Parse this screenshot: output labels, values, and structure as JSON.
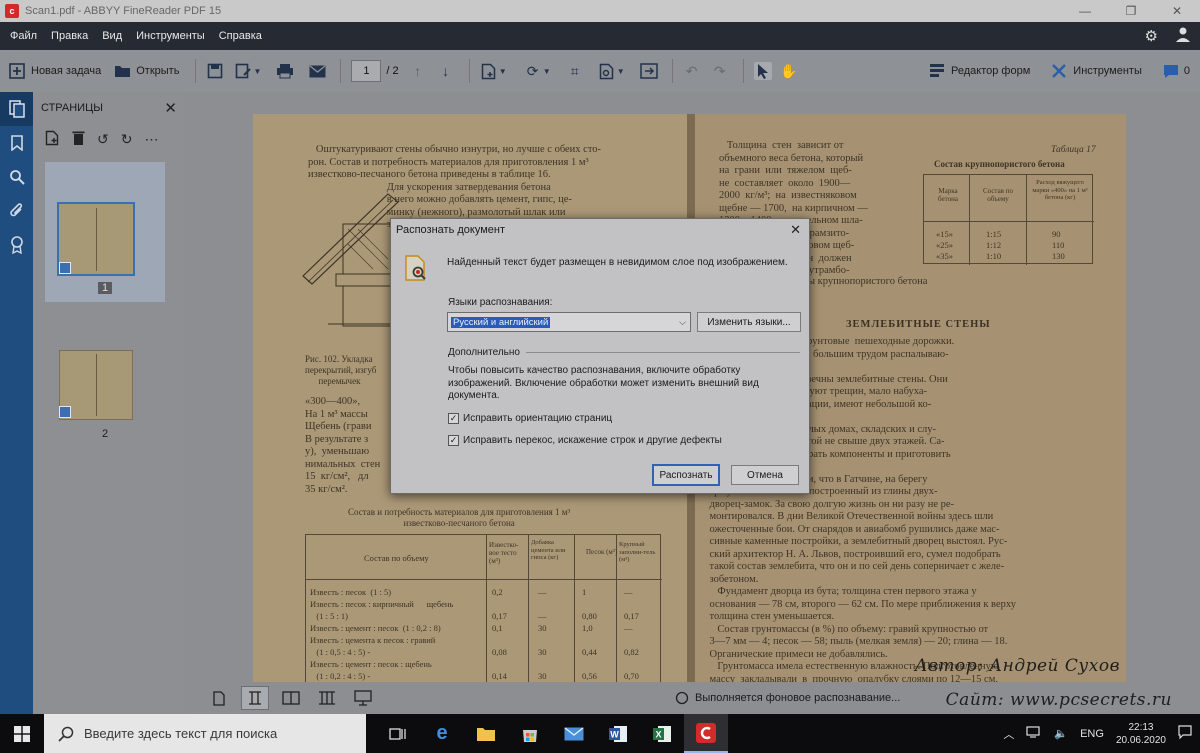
{
  "window": {
    "title": "Scan1.pdf - ABBYY FineReader PDF 15",
    "controls": [
      "—",
      "❐",
      "✕"
    ]
  },
  "menu": [
    "Файл",
    "Правка",
    "Вид",
    "Инструменты",
    "Справка"
  ],
  "toolbar": {
    "new_task": "Новая задача",
    "open": "Открыть",
    "page_current": "1",
    "page_total": "/ 2",
    "form_editor": "Редактор форм",
    "tools": "Инструменты",
    "comments_count": "0"
  },
  "pages_panel": {
    "title": "СТРАНИЦЫ",
    "close": "✕",
    "pages": [
      {
        "number": "1",
        "selected": true
      },
      {
        "number": "2",
        "selected": false
      }
    ]
  },
  "document": {
    "left_page": {
      "top_text": [
        "   Оштукатуривают стены обычно изнутри, но лучше с обеих сто-",
        "рон. Состав и потребность материалов для приготовления 1 м³",
        "известково-песчаного бетона приведены в таблице 16.",
        "                              Для ускорения затвердевания бетона",
        "                              в него можно добавлять цемент, гипс, це-",
        "                              минку (нежного), размолотый шлак или",
        "                              золу в количестве до 20% от веса изв."
      ],
      "caption": [
        "Рис. 102. Укладка",
        "перекрытий, изгуб",
        "      перемычек"
      ],
      "mid_text": [
        "«300—400»,",
        "На 1 м³ массы",
        "Щебень (грави",
        "В результате з",
        "у),  уменьшаю",
        "нимальных  стен",
        "15  кг/см²,   дл",
        "35 кг/см²."
      ],
      "table_title": [
        "Состав и потребность материалов для приготовления 1 м³",
        "известково-песчаного бетона"
      ],
      "table_headers": [
        "Состав по объему",
        "Известко-вое тесто (м³)",
        "Добавка цемента или гипса (кг)",
        "Песок (м³)",
        "Крупный заполни-тель (м³)"
      ],
      "table_rows": [
        [
          "Известь : песок  (1 : 5)",
          "0,2",
          "—",
          "1",
          "—"
        ],
        [
          "Известь : песок : кирпичный      щебень",
          "",
          "",
          "",
          ""
        ],
        [
          "   (1 : 5 : 1)",
          "0,17",
          "—",
          "0,80",
          "0,17"
        ],
        [
          "Известь : цемент : песок  (1 : 0,2 : 8)",
          "0,1",
          "30",
          "1,0",
          "—"
        ],
        [
          "Известь : цемента к песок : гравий",
          "",
          "",
          "",
          ""
        ],
        [
          "   (1 : 0,5 : 4 : 5) -",
          "0,08",
          "30",
          "0,44",
          "0,82"
        ],
        [
          "Известь : цемент : песок : щебень",
          "",
          "",
          "",
          ""
        ],
        [
          "   (1 : 0,2 : 4 : 5) -",
          "0,14",
          "30",
          "0,56",
          "0,70"
        ]
      ]
    },
    "right_page": {
      "top_text": [
        "   Толщина  стен  зависит от",
        "объемного веса бетона, который",
        "на  грани  или  тяжелом  щеб-",
        "не  составляет  около  1900—",
        "2000  кг/м³;  на  известняковом",
        "щебне — 1700,  на кирпичном —",
        "1300—1400,  на котельном шла-",
        "                       ,  на керамзито-",
        "                          пемзовом щеб-",
        "                          Бетон  должен",
        "                          туго утрамбо-"
      ],
      "table_label": "Таблица 17",
      "table_title": "Состав крупнопористого бетона",
      "table_headers": [
        "Марка бетона",
        "Состав по объему",
        "Расход вяжущего марки «400» на 1 м³ бетона (кг)"
      ],
      "table_rows": [
        [
          "«15»",
          "1:15",
          "90"
        ],
        [
          "«25»",
          "1:12",
          "110"
        ],
        [
          "«35»",
          "1:10",
          "130"
        ]
      ],
      "line1": "                    е составы крупнопористого бетона",
      "section_title": "ЗЕМЛЕБИТНЫЕ СТЕНЫ",
      "body_text": [
        "    распрашно  прочны  грунтовые  пешеходные дорожки.",
        "    лоснятся  дождями и с большим трудом распалываю-",
        "",
        "    очень прочны в долговечны землебитные стены. Они",
        "    ксуслу, почти не образуют трещин, мало набуха-",
        "    устойчивы в эксплуатации, имеют небольшой ко-",
        "    оводность.",
        "       стены возводят в жилых домах, складских и слу-",
        "    жебных зданиях высотой не свыше двух этажей. Са-",
        "    ч есть — умело подобрать компоненты и приготовить",
        "",
        "         ем мы уже говорили, что в Гатчине, на берегу",
        "    ера уже 175 лет стоит построенный из глины двух-",
        "    дворец-замок. За свою долгую жизнь он ни разу не ре-",
        "    монтировался. В дни Великой Отечественной войны здесь шли",
        "    ожесточенные бои. От снарядов и авиабомб рушились даже мас-",
        "    сивные каменные постройки, а землебитный дворец выстоял. Рус-",
        "    ский архитектор Н. А. Львов, построивший его, сумел подобрать",
        "    такой состав землебита, что он и по сей день соперничает с желе-",
        "    зобетоном.",
        "       Фундамент дворца из бута; толщина стен первого этажа у",
        "    основания — 78 см, второго — 62 см. По мере приближения к верху",
        "    толщина стен уменьшается.",
        "       Состав грунтомассы (в %) по объему: гравий крупностью от",
        "    3—7 мм — 4; песок — 58; пыль (мелкая земля) — 20; глина — 18.",
        "    Органические примеси не добавлялись.",
        "       Грунтомасса имела естественную влажность. Подготовленную",
        "    массу  закладывали  в  прочную  опалубку слоями по 12—15 см,",
        "    трамбовали,  заливали  6-миллиметровым  слоем  жидкой  известко-"
      ]
    }
  },
  "dialog": {
    "title": "Распознать документ",
    "info": "Найденный текст будет размещен в невидимом слое под изображением.",
    "languages_label": "Языки распознавания:",
    "languages_value": "Русский и английский",
    "change_languages": "Изменить языки...",
    "additional_title": "Дополнительно",
    "description": "Чтобы повысить качество распознавания, включите обработку изображений. Включение обработки может изменить внешний вид документа.",
    "check_orientation": "Исправить ориентацию страниц",
    "check_skew": "Исправить перекос, искажение строк и другие дефекты",
    "recognize": "Распознать",
    "cancel": "Отмена"
  },
  "statusbar": {
    "status": "Выполняется фоновое распознавание..."
  },
  "watermark": {
    "line1": "Автор: Андрей Сухов",
    "line2": "Сайт: www.pcsecrets.ru"
  },
  "taskbar": {
    "search_placeholder": "Введите здесь текст для поиска",
    "lang": "ENG",
    "time": "22:13",
    "date": "20.06.2020"
  }
}
